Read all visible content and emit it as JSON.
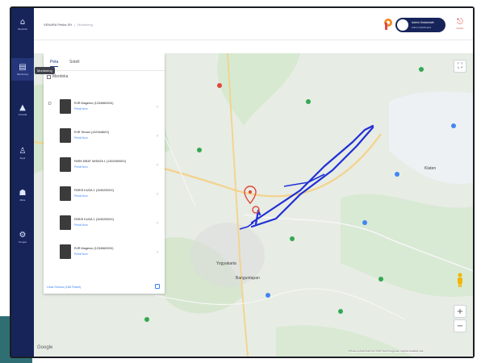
{
  "header": {
    "breadcrumb_root": "VENARA Pekka SH",
    "breadcrumb_current": "Monitoring",
    "user_name": "Admin Kedaimath",
    "user_role": "Admin Dashboard",
    "logout_label": "Keluar"
  },
  "sidebar": {
    "items": [
      {
        "icon": "home-icon",
        "glyph": "⌂",
        "label": "Beranda"
      },
      {
        "icon": "monitor-icon",
        "glyph": "▤",
        "label": "Monitoring"
      },
      {
        "icon": "vehicle-icon",
        "glyph": "▲",
        "label": "Armada"
      },
      {
        "icon": "person-icon",
        "glyph": "♙",
        "label": "Supir"
      },
      {
        "icon": "users-icon",
        "glyph": "☗",
        "label": "Mitra"
      },
      {
        "icon": "settings-icon",
        "glyph": "⚙",
        "label": "Pengat"
      }
    ],
    "tooltip": "Monitoring"
  },
  "panel": {
    "tab_active": "Peta",
    "tab_other": "Sotell",
    "filter_label": "Merdeka",
    "side_letter": "D",
    "rows": [
      {
        "title": "RJR Magenro (123456000X)",
        "sub": "Petroli Num"
      },
      {
        "title": "RJR Temari (1223468XX)",
        "sub": "Petroli Num"
      },
      {
        "title": "PARK BRAT WISATA 1 (130205000X)",
        "sub": "Petroli Num"
      },
      {
        "title": "PARIS KUDA 1 (1045290XX)",
        "sub": "Petroli Num"
      },
      {
        "title": "PARIS KUDA 1 (1045290XX)",
        "sub": "Petroli Num"
      },
      {
        "title": "RJR Magenro (123456000X)",
        "sub": "Petroli Num"
      }
    ],
    "view_all": "Lihat Semua (186 Paket)"
  },
  "map": {
    "places": [
      {
        "name": "Yogyakarta"
      },
      {
        "name": "Klaten"
      },
      {
        "name": "Banguntapan"
      }
    ],
    "google_label": "Google",
    "attribution": "Pintasan keyboard   Data Peta ©2022   Syarat Penggunaan   Laporkan kesalahan peta",
    "zoom_in": "+",
    "zoom_out": "−",
    "fullscreen_icon": "fullscreen-icon",
    "route_color": "#1f2fd6",
    "marker_color": "#e0473a"
  }
}
